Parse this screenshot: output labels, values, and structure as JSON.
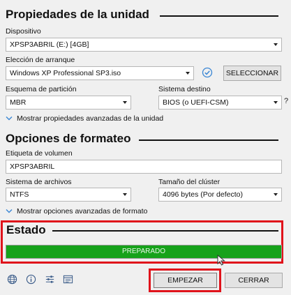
{
  "device_properties": {
    "title": "Propiedades de la unidad",
    "device_label": "Dispositivo",
    "device_value": "XPSP3ABRIL (E:) [4GB]",
    "boot_label": "Elección de arranque",
    "boot_value": "Windows XP Professional SP3.iso",
    "select_button": "SELECCIONAR",
    "partition_label": "Esquema de partición",
    "partition_value": "MBR",
    "target_label": "Sistema destino",
    "target_value": "BIOS (o UEFI-CSM)",
    "help_mark": "?",
    "advanced_toggle": "Mostrar propiedades avanzadas de la unidad"
  },
  "format_options": {
    "title": "Opciones de formateo",
    "volume_label": "Etiqueta de volumen",
    "volume_value": "XPSP3ABRIL",
    "filesystem_label": "Sistema de archivos",
    "filesystem_value": "NTFS",
    "cluster_label": "Tamaño del clúster",
    "cluster_value": "4096 bytes (Por defecto)",
    "advanced_toggle": "Mostrar opciones avanzadas de formato"
  },
  "status": {
    "title": "Estado",
    "progress_text": "PREPARADO",
    "progress_fraction": 1.0,
    "progress_color": "#16a21a",
    "highlight_color": "#e0131b"
  },
  "footer": {
    "icons": [
      "globe-icon",
      "info-icon",
      "settings-sliders-icon",
      "log-icon"
    ],
    "start_button": "EMPEZAR",
    "close_button": "CERRAR"
  }
}
